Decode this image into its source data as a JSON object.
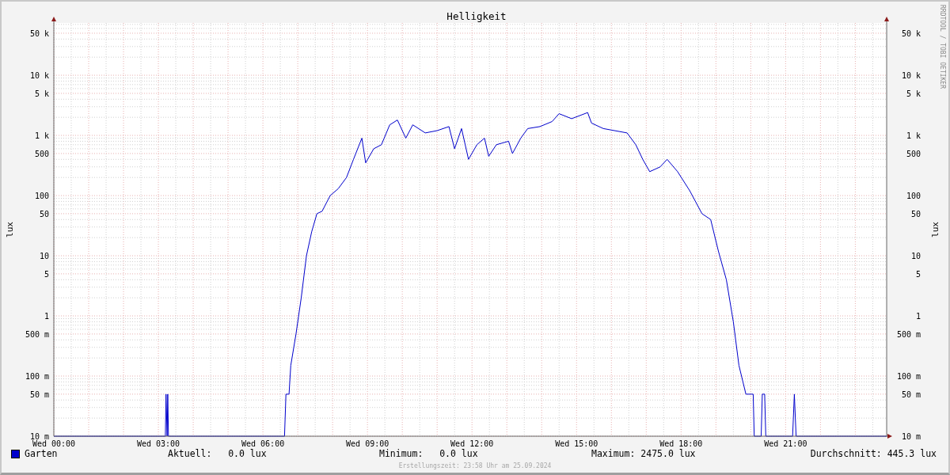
{
  "chart": {
    "title": "Helligkeit",
    "credit": "RRDTOOL / TOBI OETIKER",
    "left_axis": {
      "label": "lux",
      "tick_labels": [
        "50 k",
        "10 k",
        "5 k",
        "1 k",
        "500",
        "100",
        "50",
        "10",
        "5",
        "1",
        "500 m",
        "100 m",
        "50 m",
        "10 m"
      ]
    },
    "right_axis": {
      "label": "lux",
      "tick_labels": [
        "50 k",
        "10 k",
        "5 k",
        "1 k",
        "500",
        "100",
        "50",
        "10",
        "5",
        "1",
        "500 m",
        "100 m",
        "50 m",
        "10 m"
      ]
    },
    "time_axis": {
      "tick_labels": [
        "Wed 00:00",
        "Wed 03:00",
        "Wed 06:00",
        "Wed 09:00",
        "Wed 12:00",
        "Wed 15:00",
        "Wed 18:00",
        "Wed 21:00"
      ]
    }
  },
  "legend": {
    "name": "Garten",
    "color": "#0000cc"
  },
  "stats": [
    {
      "label": "Aktuell:",
      "value": "0.0 lux"
    },
    {
      "label": "Minimum:",
      "value": "0.0 lux"
    },
    {
      "label": "Maximum:",
      "value": "2475.0 lux"
    },
    {
      "label": "Durchschnitt:",
      "value": "445.3 lux"
    }
  ],
  "footer": "Erstellungszeit: 23:58 Uhr am 25.09.2024"
}
